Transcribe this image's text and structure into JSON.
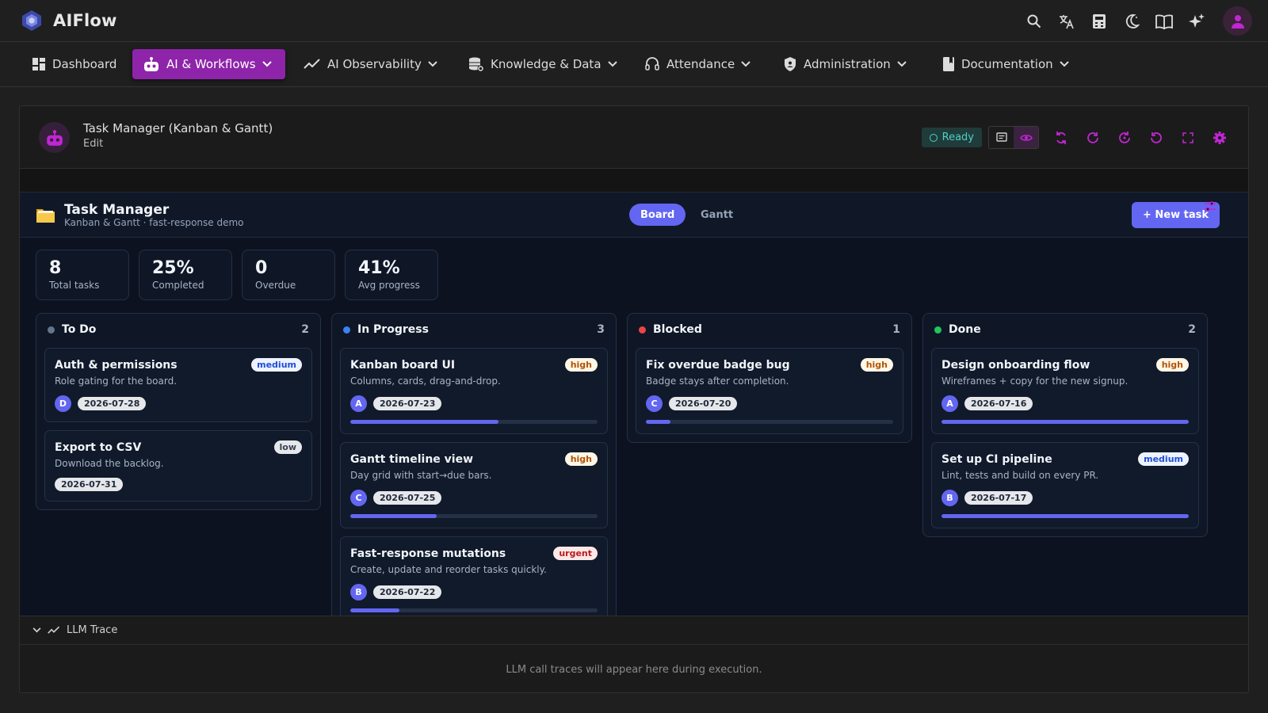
{
  "app": {
    "name": "AIFlow"
  },
  "topbar": {
    "icons": [
      "search-icon",
      "translate-icon",
      "calculator-icon",
      "dark-mode-icon",
      "book-icon",
      "sparkles-icon",
      "user-icon"
    ]
  },
  "nav": {
    "items": [
      {
        "label": "Dashboard",
        "icon": "dashboard-icon",
        "dropdown": false,
        "active": false
      },
      {
        "label": "AI & Workflows",
        "icon": "robot-icon",
        "dropdown": true,
        "active": true
      },
      {
        "label": "AI Observability",
        "icon": "trend-icon",
        "dropdown": true,
        "active": false
      },
      {
        "label": "Knowledge & Data",
        "icon": "database-icon",
        "dropdown": true,
        "active": false
      },
      {
        "label": "Attendance",
        "icon": "headset-icon",
        "dropdown": true,
        "active": false
      },
      {
        "label": "Administration",
        "icon": "shield-icon",
        "dropdown": true,
        "active": false
      },
      {
        "label": "Documentation",
        "icon": "book-icon",
        "dropdown": true,
        "active": false
      }
    ]
  },
  "agent": {
    "title": "Task Manager (Kanban & Gantt)",
    "edit_label": "Edit",
    "status": "Ready"
  },
  "task_app": {
    "title": "Task Manager",
    "subtitle": "Kanban & Gantt · fast-response demo",
    "tabs": {
      "board": "Board",
      "gantt": "Gantt",
      "active": "Board"
    },
    "new_task_label": "+ New task",
    "stats": [
      {
        "value": "8",
        "label": "Total tasks"
      },
      {
        "value": "25%",
        "label": "Completed"
      },
      {
        "value": "0",
        "label": "Overdue"
      },
      {
        "value": "41%",
        "label": "Avg progress"
      }
    ],
    "columns": [
      {
        "name": "To Do",
        "count": "2",
        "color": "#64748b",
        "cards": [
          {
            "title": "Auth & permissions",
            "desc": "Role gating for the board.",
            "priority": "medium",
            "assignee": "D",
            "due": "2026-07-28",
            "progress": null
          },
          {
            "title": "Export to CSV",
            "desc": "Download the backlog.",
            "priority": "low",
            "assignee": "",
            "due": "2026-07-31",
            "progress": null
          }
        ]
      },
      {
        "name": "In Progress",
        "count": "3",
        "color": "#3b82f6",
        "cards": [
          {
            "title": "Kanban board UI",
            "desc": "Columns, cards, drag-and-drop.",
            "priority": "high",
            "assignee": "A",
            "due": "2026-07-23",
            "progress": 0.6
          },
          {
            "title": "Gantt timeline view",
            "desc": "Day grid with start→due bars.",
            "priority": "high",
            "assignee": "C",
            "due": "2026-07-25",
            "progress": 0.35
          },
          {
            "title": "Fast-response mutations",
            "desc": "Create, update and reorder tasks quickly.",
            "priority": "urgent",
            "assignee": "B",
            "due": "2026-07-22",
            "progress": 0.2
          }
        ]
      },
      {
        "name": "Blocked",
        "count": "1",
        "color": "#ef4444",
        "cards": [
          {
            "title": "Fix overdue badge bug",
            "desc": "Badge stays after completion.",
            "priority": "high",
            "assignee": "C",
            "due": "2026-07-20",
            "progress": 0.1
          }
        ]
      },
      {
        "name": "Done",
        "count": "2",
        "color": "#22c55e",
        "cards": [
          {
            "title": "Design onboarding flow",
            "desc": "Wireframes + copy for the new signup.",
            "priority": "high",
            "assignee": "A",
            "due": "2026-07-16",
            "progress": 1.0
          },
          {
            "title": "Set up CI pipeline",
            "desc": "Lint, tests and build on every PR.",
            "priority": "medium",
            "assignee": "B",
            "due": "2026-07-17",
            "progress": 1.0
          }
        ]
      }
    ]
  },
  "trace": {
    "label": "LLM Trace",
    "empty_text": "LLM call traces will appear here during execution."
  }
}
